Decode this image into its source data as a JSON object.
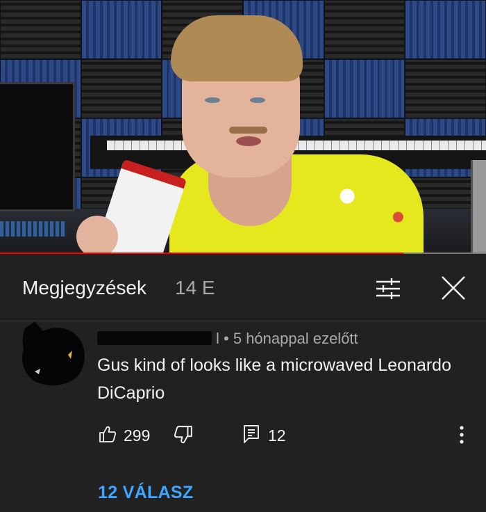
{
  "video": {
    "progress": 0.83
  },
  "comments_panel": {
    "title": "Megjegyzések",
    "count": "14 E",
    "sort_icon": "sort-filter-icon",
    "close_icon": "close-icon"
  },
  "comment": {
    "author_visible_suffix": "l",
    "separator": "•",
    "time": "5 hónappal ezelőtt",
    "text": "Gus kind of looks like a microwaved Leonardo DiCaprio",
    "likes": "299",
    "replies_count": "12",
    "replies_link": "12 VÁLASZ"
  },
  "colors": {
    "background": "#212121",
    "progress": "#ff0000",
    "link": "#3ea6ff"
  }
}
